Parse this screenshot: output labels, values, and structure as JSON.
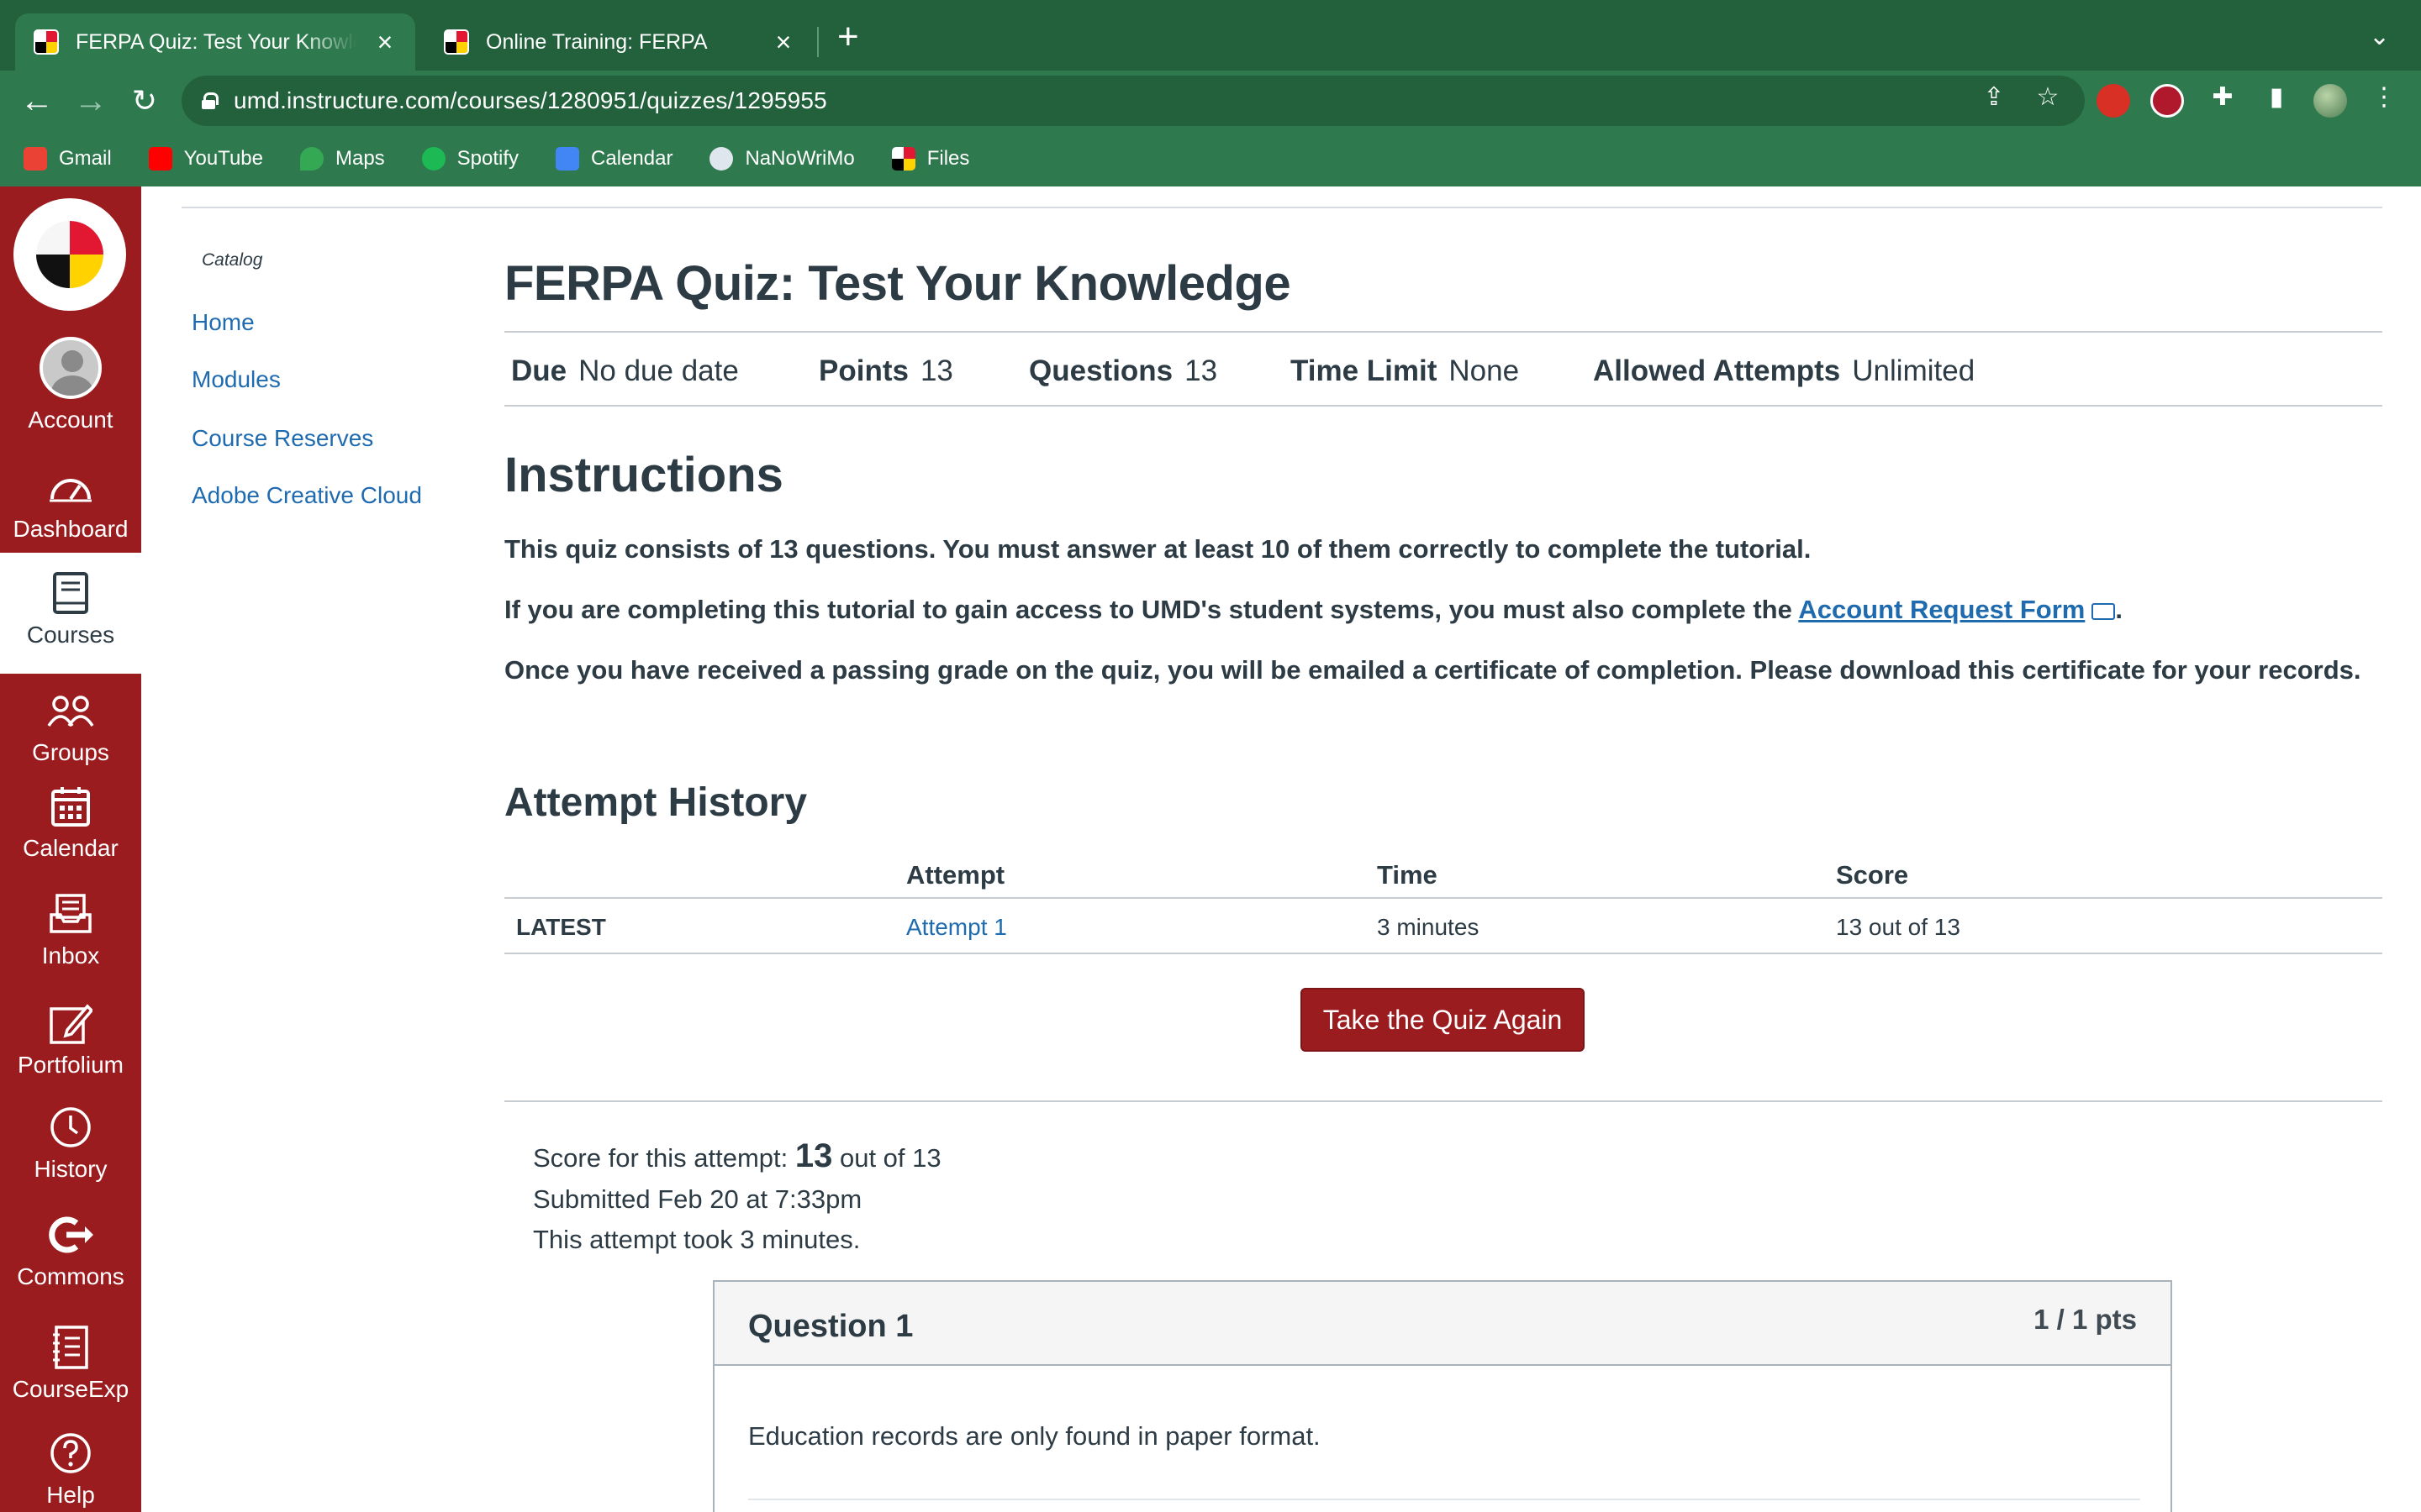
{
  "browser": {
    "tabs": [
      {
        "title": "FERPA Quiz: Test Your Knowledge",
        "active": true
      },
      {
        "title": "Online Training: FERPA",
        "active": false
      }
    ],
    "url": "umd.instructure.com/courses/1280951/quizzes/1295955",
    "bookmarks": [
      {
        "label": "Gmail",
        "icon": "gmail-icon",
        "color": "#ea4335"
      },
      {
        "label": "YouTube",
        "icon": "youtube-icon",
        "color": "#ff0000"
      },
      {
        "label": "Maps",
        "icon": "maps-icon",
        "color": "#34a853"
      },
      {
        "label": "Spotify",
        "icon": "spotify-icon",
        "color": "#1db954"
      },
      {
        "label": "Calendar",
        "icon": "calendar-icon",
        "color": "#4285f4"
      },
      {
        "label": "NaNoWriMo",
        "icon": "nanowrimo-icon",
        "color": "#dfe6ee"
      },
      {
        "label": "Files",
        "icon": "umd-files-icon",
        "color": "#e21833"
      }
    ]
  },
  "global_nav": {
    "items": [
      {
        "label": "Account",
        "icon": "account-avatar-icon"
      },
      {
        "label": "Dashboard",
        "icon": "dashboard-icon"
      },
      {
        "label": "Courses",
        "icon": "courses-icon",
        "active": true
      },
      {
        "label": "Groups",
        "icon": "groups-icon"
      },
      {
        "label": "Calendar",
        "icon": "calendar-icon"
      },
      {
        "label": "Inbox",
        "icon": "inbox-icon"
      },
      {
        "label": "Portfolium",
        "icon": "portfolium-icon"
      },
      {
        "label": "History",
        "icon": "history-icon"
      },
      {
        "label": "Commons",
        "icon": "commons-icon"
      },
      {
        "label": "CourseExp",
        "icon": "courseexp-icon"
      },
      {
        "label": "Help",
        "icon": "help-icon"
      }
    ],
    "brand_color": "#9b1c1f"
  },
  "course_nav": {
    "catalog_label": "Catalog",
    "links": [
      "Home",
      "Modules",
      "Course Reserves",
      "Adobe Creative Cloud"
    ]
  },
  "quiz": {
    "title": "FERPA Quiz: Test Your Knowledge",
    "details": [
      {
        "label": "Due",
        "value": "No due date"
      },
      {
        "label": "Points",
        "value": "13"
      },
      {
        "label": "Questions",
        "value": "13"
      },
      {
        "label": "Time Limit",
        "value": "None"
      },
      {
        "label": "Allowed Attempts",
        "value": "Unlimited"
      }
    ],
    "instructions_heading": "Instructions",
    "instructions": {
      "p1": "This quiz consists of 13 questions. You must answer at least 10 of them correctly to complete the tutorial.",
      "p2_before": "If you are completing this tutorial to gain access to UMD's student systems, you must also complete the ",
      "p2_link": "Account Request Form",
      "p2_after": ".",
      "p3": "Once you have received a passing grade on the quiz, you will be emailed a certificate of completion. Please download this certificate for your records."
    },
    "attempt_history": {
      "heading": "Attempt History",
      "columns": [
        "",
        "Attempt",
        "Time",
        "Score"
      ],
      "rows": [
        {
          "label": "LATEST",
          "attempt": "Attempt 1",
          "time": "3 minutes",
          "score": "13 out of 13"
        }
      ]
    },
    "retake_label": "Take the Quiz Again",
    "summary": {
      "score_prefix": "Score for this attempt: ",
      "score_value": "13",
      "score_suffix": " out of 13",
      "submitted": "Submitted Feb 20 at 7:33pm",
      "duration": "This attempt took 3 minutes."
    },
    "question": {
      "name": "Question 1",
      "points": "1 / 1 pts",
      "text": "Education records are only found in paper format."
    }
  }
}
